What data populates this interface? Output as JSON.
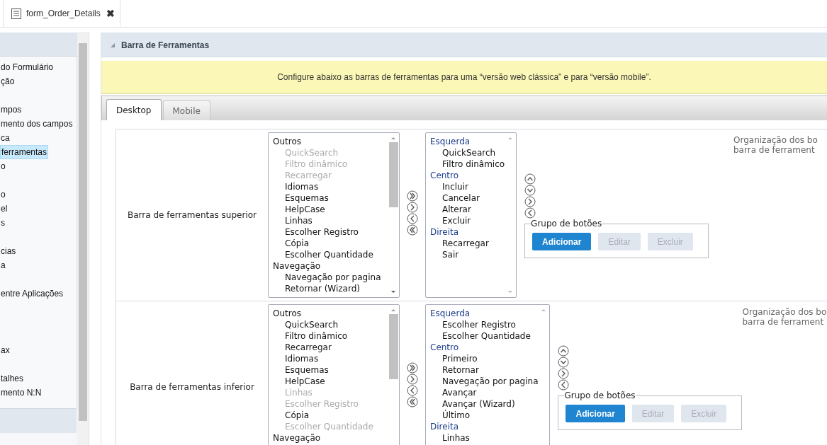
{
  "doc_tab": {
    "title": "form_Order_Details",
    "close": "✖"
  },
  "sidebar": {
    "items": [
      {
        "kind": "item",
        "label": "do Formulário",
        "selected": false
      },
      {
        "kind": "item",
        "label": "ção",
        "selected": false
      },
      {
        "kind": "blank"
      },
      {
        "kind": "item",
        "label": "mpos",
        "selected": false
      },
      {
        "kind": "item",
        "label": "mento dos campos",
        "selected": false
      },
      {
        "kind": "item",
        "label": "ca",
        "selected": false
      },
      {
        "kind": "item",
        "label": "ferramentas",
        "selected": true
      },
      {
        "kind": "item",
        "label": "o",
        "selected": false
      },
      {
        "kind": "blank"
      },
      {
        "kind": "item",
        "label": "o",
        "selected": false
      },
      {
        "kind": "item",
        "label": "el",
        "selected": false
      },
      {
        "kind": "item",
        "label": "s",
        "selected": false
      },
      {
        "kind": "blank"
      },
      {
        "kind": "item",
        "label": "cias",
        "selected": false
      },
      {
        "kind": "item",
        "label": "a",
        "selected": false
      },
      {
        "kind": "blank"
      },
      {
        "kind": "item",
        "label": "entre Aplicações",
        "selected": false
      },
      {
        "kind": "blank"
      },
      {
        "kind": "blank"
      },
      {
        "kind": "blank"
      },
      {
        "kind": "item",
        "label": "ax",
        "selected": false
      },
      {
        "kind": "blank"
      },
      {
        "kind": "item",
        "label": "talhes",
        "selected": false
      },
      {
        "kind": "item",
        "label": "mento N:N",
        "selected": false
      }
    ]
  },
  "panel": {
    "title": "Barra de Ferramentas",
    "notice": "Configure abaixo as barras de ferramentas para uma “versão web clássica” e para “versão mobile”.",
    "tabs": [
      {
        "label": "Desktop",
        "selected": true
      },
      {
        "label": "Mobile",
        "selected": false
      }
    ],
    "toolbars": [
      {
        "label": "Barra de ferramentas superior",
        "available": [
          {
            "kind": "group",
            "label": "Outros"
          },
          {
            "kind": "option",
            "label": "QuickSearch",
            "disabled": true
          },
          {
            "kind": "option",
            "label": "Filtro dinâmico",
            "disabled": true
          },
          {
            "kind": "option",
            "label": "Recarregar",
            "disabled": true
          },
          {
            "kind": "option",
            "label": "Idiomas",
            "disabled": false
          },
          {
            "kind": "option",
            "label": "Esquemas",
            "disabled": false
          },
          {
            "kind": "option",
            "label": "HelpCase",
            "disabled": false
          },
          {
            "kind": "option",
            "label": "Linhas",
            "disabled": false
          },
          {
            "kind": "option",
            "label": "Escolher Registro",
            "disabled": false
          },
          {
            "kind": "option",
            "label": "Cópia",
            "disabled": false
          },
          {
            "kind": "option",
            "label": "Escolher Quantidade",
            "disabled": false
          },
          {
            "kind": "group",
            "label": "Navegação"
          },
          {
            "kind": "option",
            "label": "Navegação por pagina",
            "disabled": false
          },
          {
            "kind": "option",
            "label": "Retornar (Wizard)",
            "disabled": false
          }
        ],
        "chosen": [
          {
            "kind": "group",
            "label": "Esquerda"
          },
          {
            "kind": "option",
            "label": "QuickSearch",
            "disabled": false
          },
          {
            "kind": "option",
            "label": "Filtro dinâmico",
            "disabled": false
          },
          {
            "kind": "group",
            "label": "Centro"
          },
          {
            "kind": "option",
            "label": "Incluir",
            "disabled": false
          },
          {
            "kind": "option",
            "label": "Cancelar",
            "disabled": false
          },
          {
            "kind": "option",
            "label": "Alterar",
            "disabled": false
          },
          {
            "kind": "option",
            "label": "Excluir",
            "disabled": false
          },
          {
            "kind": "group",
            "label": "Direita"
          },
          {
            "kind": "option",
            "label": "Recarregar",
            "disabled": false
          },
          {
            "kind": "option",
            "label": "Sair",
            "disabled": false
          }
        ],
        "group_box": {
          "legend": "Grupo de botões",
          "buttons": [
            {
              "label": "Adicionar",
              "disabled": false
            },
            {
              "label": "Editar",
              "disabled": true
            },
            {
              "label": "Excluir",
              "disabled": true
            }
          ]
        },
        "help_lines": [
          "Organização dos bo",
          "barra de ferrament"
        ]
      },
      {
        "label": "Barra de ferramentas inferior",
        "available": [
          {
            "kind": "group",
            "label": "Outros"
          },
          {
            "kind": "option",
            "label": "QuickSearch",
            "disabled": false
          },
          {
            "kind": "option",
            "label": "Filtro dinâmico",
            "disabled": false
          },
          {
            "kind": "option",
            "label": "Recarregar",
            "disabled": false
          },
          {
            "kind": "option",
            "label": "Idiomas",
            "disabled": false
          },
          {
            "kind": "option",
            "label": "Esquemas",
            "disabled": false
          },
          {
            "kind": "option",
            "label": "HelpCase",
            "disabled": false
          },
          {
            "kind": "option",
            "label": "Linhas",
            "disabled": true
          },
          {
            "kind": "option",
            "label": "Escolher Registro",
            "disabled": true
          },
          {
            "kind": "option",
            "label": "Cópia",
            "disabled": false
          },
          {
            "kind": "option",
            "label": "Escolher Quantidade",
            "disabled": true
          },
          {
            "kind": "group",
            "label": "Navegação"
          }
        ],
        "chosen": [
          {
            "kind": "group",
            "label": "Esquerda"
          },
          {
            "kind": "option",
            "label": "Escolher Registro",
            "disabled": false
          },
          {
            "kind": "option",
            "label": "Escolher Quantidade",
            "disabled": false
          },
          {
            "kind": "group",
            "label": "Centro"
          },
          {
            "kind": "option",
            "label": "Primeiro",
            "disabled": false
          },
          {
            "kind": "option",
            "label": "Retornar",
            "disabled": false
          },
          {
            "kind": "option",
            "label": "Navegação por pagina",
            "disabled": false
          },
          {
            "kind": "option",
            "label": "Avançar",
            "disabled": false
          },
          {
            "kind": "option",
            "label": "Avançar (Wizard)",
            "disabled": false
          },
          {
            "kind": "option",
            "label": "Último",
            "disabled": false
          },
          {
            "kind": "group",
            "label": "Direita"
          },
          {
            "kind": "option",
            "label": "Linhas",
            "disabled": false
          }
        ],
        "group_box": {
          "legend": "Grupo de botões",
          "buttons": [
            {
              "label": "Adicionar",
              "disabled": false
            },
            {
              "label": "Editar",
              "disabled": true
            },
            {
              "label": "Excluir",
              "disabled": true
            }
          ]
        },
        "help_lines": [
          "Organização dos bo",
          "barra de ferrament"
        ]
      }
    ]
  }
}
